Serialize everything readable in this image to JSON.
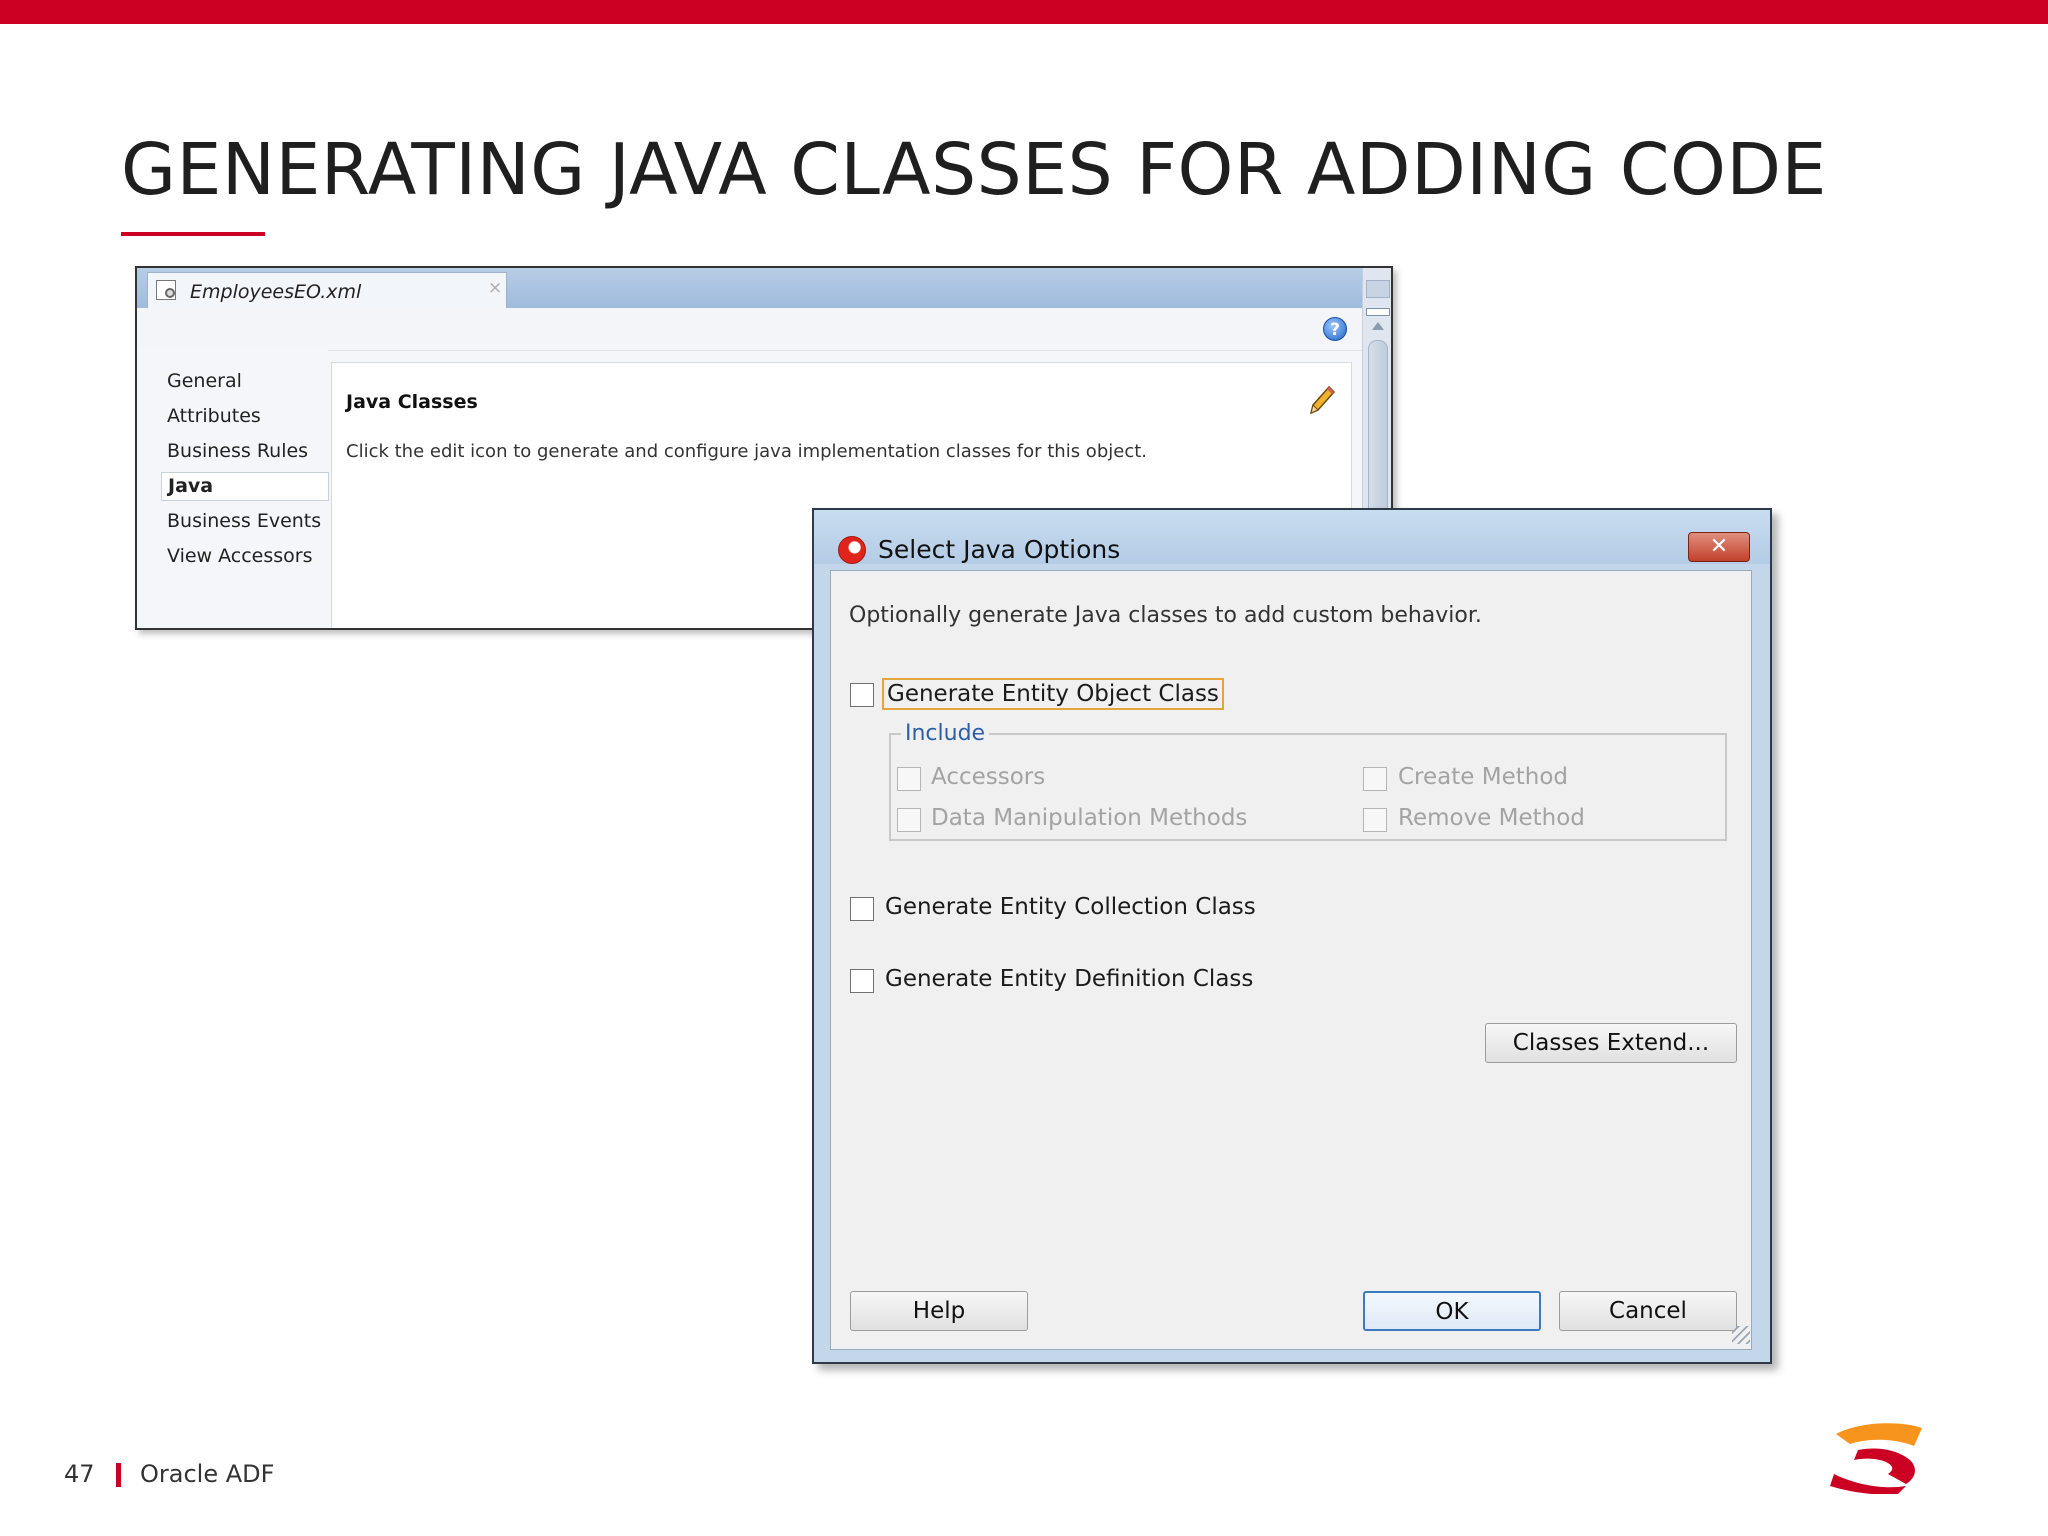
{
  "slide": {
    "title": "GENERATING JAVA CLASSES FOR ADDING CODE",
    "page_number": "47",
    "footer_text": "Oracle ADF",
    "accent_color": "#cc0022"
  },
  "editor": {
    "tab_label": "EmployeesEO.xml",
    "tab_close": "×",
    "help_icon": "?",
    "nav_items": [
      "General",
      "Attributes",
      "Business Rules",
      "Java",
      "Business Events",
      "View Accessors"
    ],
    "selected_nav": "Java",
    "section_title": "Java Classes",
    "section_description": "Click the edit icon to generate and configure java implementation classes for this object."
  },
  "dialog": {
    "title": "Select Java Options",
    "close_glyph": "✕",
    "intro": "Optionally generate Java classes to add custom behavior.",
    "entity_object_class": {
      "label": "Generate Entity Object Class",
      "checked": false
    },
    "include": {
      "legend": "Include",
      "accessors": {
        "label": "Accessors",
        "enabled": false
      },
      "create_method": {
        "label": "Create Method",
        "enabled": false
      },
      "dml_methods": {
        "label": "Data Manipulation Methods",
        "enabled": false
      },
      "remove_method": {
        "label": "Remove Method",
        "enabled": false
      }
    },
    "entity_collection_class": {
      "label": "Generate Entity Collection Class",
      "checked": false
    },
    "entity_definition_class": {
      "label": "Generate Entity Definition Class",
      "checked": false
    },
    "classes_extend_button": "Classes Extend...",
    "help_button": "Help",
    "ok_button": "OK",
    "cancel_button": "Cancel"
  }
}
